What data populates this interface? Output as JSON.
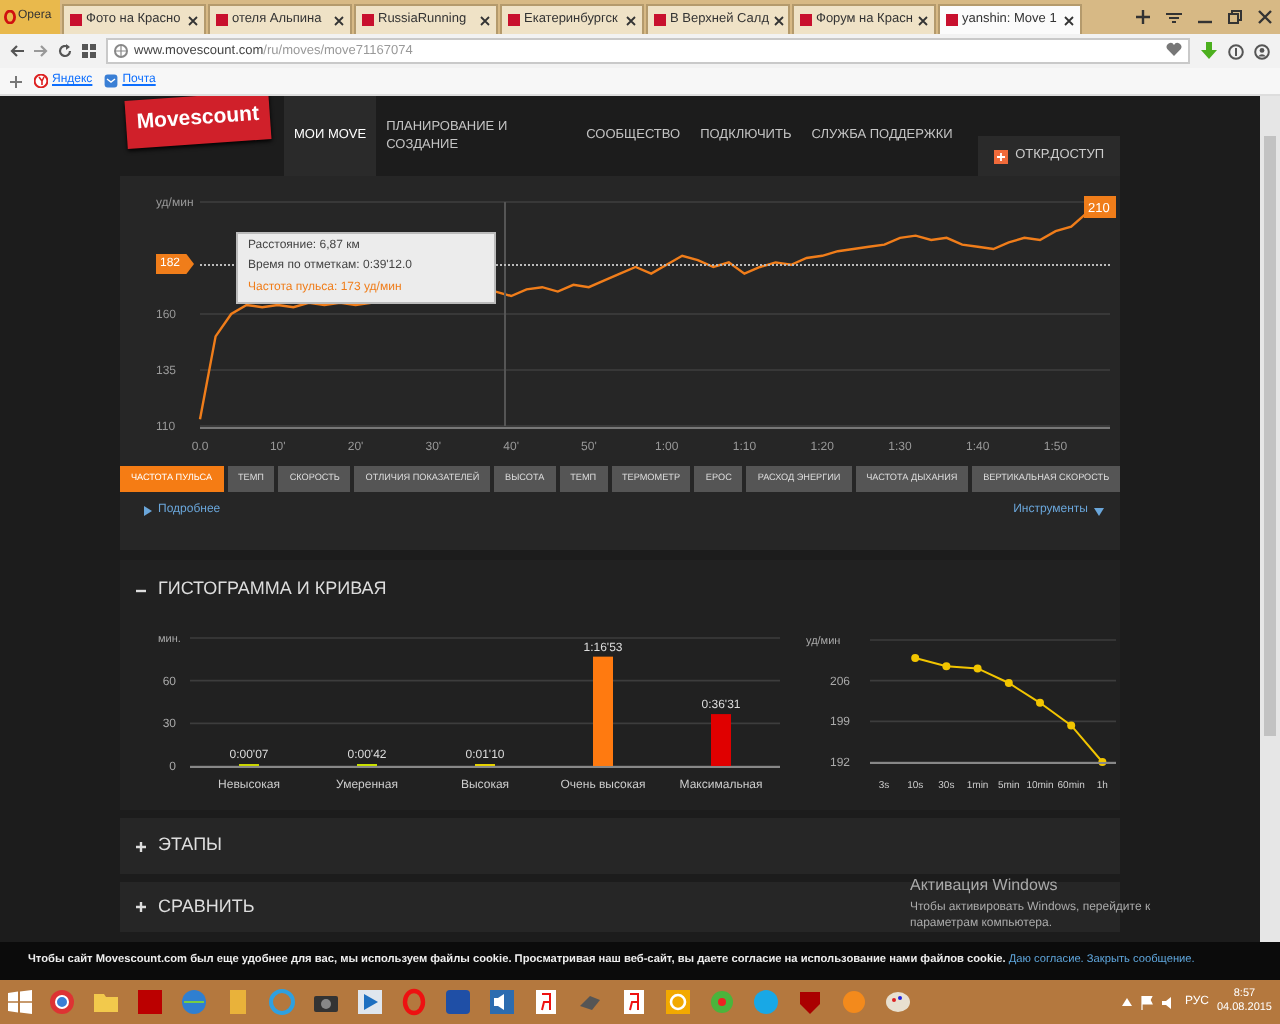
{
  "browser": {
    "menu_button": "Opera",
    "tabs": [
      {
        "title": "Фото на Красно",
        "selected": false
      },
      {
        "title": "отеля Альпина",
        "selected": false
      },
      {
        "title": "RussiaRunning",
        "selected": false
      },
      {
        "title": "Екатеринбургск",
        "selected": false
      },
      {
        "title": "В Верхней Салд",
        "selected": false
      },
      {
        "title": "Форум на Красн",
        "selected": false
      },
      {
        "title": "yanshin: Move 1",
        "selected": true
      }
    ],
    "address": {
      "host": "www.movescount.com",
      "path": "/ru/moves/move71167074"
    },
    "bookmarks": [
      "Яндекс",
      "Почта"
    ]
  },
  "site": {
    "logo": "Movescount",
    "nav": [
      {
        "label": "МОИ MOVE",
        "selected": true
      },
      {
        "label": "ПЛАНИРОВАНИЕ И СОЗДАНИЕ",
        "selected": false
      },
      {
        "label": "СООБЩЕСТВО",
        "selected": false
      },
      {
        "label": "ПОДКЛЮЧИТЬ",
        "selected": false
      },
      {
        "label": "СЛУЖБА ПОДДЕРЖКИ",
        "selected": false
      }
    ],
    "access_button": "ОТКР.ДОСТУП"
  },
  "graph": {
    "chart_data": {
      "type": "line",
      "ylabel": "уд/мин",
      "x": [
        0,
        2,
        4,
        6,
        8,
        10,
        12,
        14,
        16,
        18,
        20,
        22,
        24,
        26,
        28,
        30,
        32,
        34,
        36,
        38,
        40,
        42,
        44,
        46,
        48,
        50,
        52,
        54,
        56,
        58,
        60,
        62,
        64,
        66,
        68,
        70,
        72,
        74,
        76,
        78,
        80,
        82,
        84,
        86,
        88,
        90,
        92,
        94,
        96,
        98,
        100,
        102,
        104,
        106,
        108,
        110,
        112,
        114
      ],
      "series": [
        {
          "color": "#f07d1a",
          "values": [
            113,
            150,
            160,
            164,
            163,
            164,
            163,
            165,
            164,
            165,
            164,
            165,
            null,
            null,
            null,
            null,
            null,
            null,
            null,
            170,
            168,
            171,
            172,
            170,
            173,
            172,
            175,
            178,
            181,
            178,
            182,
            186,
            184,
            181,
            183,
            178,
            181,
            183,
            182,
            185,
            186,
            188,
            189,
            190,
            191,
            194,
            195,
            193,
            194,
            191,
            190,
            189,
            192,
            194,
            193,
            197,
            199,
            205
          ]
        }
      ],
      "xlim": [
        0,
        117
      ],
      "ylim": [
        110,
        210
      ],
      "xticks": [
        {
          "value": 0,
          "label": "0.0"
        },
        {
          "value": 10,
          "label": "10'"
        },
        {
          "value": 20,
          "label": "20'"
        },
        {
          "value": 30,
          "label": "30'"
        },
        {
          "value": 40,
          "label": "40'"
        },
        {
          "value": 50,
          "label": "50'"
        },
        {
          "value": 60,
          "label": "1:00"
        },
        {
          "value": 70,
          "label": "1:10"
        },
        {
          "value": 80,
          "label": "1:20"
        },
        {
          "value": 90,
          "label": "1:30"
        },
        {
          "value": 100,
          "label": "1:40"
        },
        {
          "value": 110,
          "label": "1:50"
        }
      ],
      "yticks": [
        110,
        135,
        160
      ]
    },
    "avg_marker": "182",
    "max_marker": "210",
    "tooltip": [
      {
        "kind": "info",
        "text": "Расстояние: 6,87 км"
      },
      {
        "kind": "info",
        "text": "Время по отметкам: 0:39'12.0"
      },
      {
        "kind": "highlight",
        "text": "Частота пульса: 173 уд/мин"
      }
    ],
    "metric_tabs": [
      {
        "label": "ЧАСТОТА ПУЛЬСА",
        "selected": true
      },
      {
        "label": "ТЕМП",
        "selected": false
      },
      {
        "label": "СКОРОСТЬ",
        "selected": false
      },
      {
        "label": "ОТЛИЧИЯ ПОКАЗАТЕЛЕЙ",
        "selected": false
      },
      {
        "label": "ВЫСОТА",
        "selected": false
      },
      {
        "label": "ТЕМП",
        "selected": false
      },
      {
        "label": "ТЕРМОМЕТР",
        "selected": false
      },
      {
        "label": "EPOC",
        "selected": false
      },
      {
        "label": "РАСХОД ЭНЕРГИИ",
        "selected": false
      },
      {
        "label": "ЧАСТОТА ДЫХАНИЯ",
        "selected": false
      },
      {
        "label": "ВЕРТИКАЛЬНАЯ СКОРОСТЬ",
        "selected": false
      }
    ],
    "details_link": "Подробнее",
    "tools_menu": "Инструменты"
  },
  "histogram_section": {
    "title": "ГИСТОГРАММА И КРИВАЯ",
    "expanded": true,
    "histogram": {
      "chart_data": {
        "type": "bar",
        "ylabel": "мин.",
        "categories": [
          "Невысокая",
          "Умеренная",
          "Высокая",
          "Очень высокая",
          "Максимальная"
        ],
        "series": [
          {
            "values": [
              0.1,
              0.7,
              1.2,
              76.9,
              36.5
            ]
          }
        ],
        "ylim": [
          0,
          90
        ],
        "yticks": [
          0,
          30,
          60
        ],
        "value_labels": [
          "0:00'07",
          "0:00'42",
          "0:01'10",
          "1:16'53",
          "0:36'31"
        ]
      }
    },
    "curve": {
      "chart_data": {
        "type": "line",
        "ylabel": "уд/мин",
        "categories": [
          "3s",
          "10s",
          "30s",
          "1min",
          "5min",
          "10min",
          "60min",
          "1h"
        ],
        "series": [
          {
            "color": "#f2c500",
            "marker": "o",
            "values": [
              null,
              209.9,
              208.5,
              208.1,
              205.6,
              202.2,
              198.3,
              192
            ]
          }
        ],
        "ylim": [
          192,
          213
        ],
        "yticks": [
          192,
          199,
          206
        ]
      }
    }
  },
  "sections": [
    {
      "title": "ЭТАПЫ",
      "expanded": false
    },
    {
      "title": "СРАВНИТЬ",
      "expanded": false
    }
  ],
  "os_notice": {
    "title": "Активация Windows",
    "text": "Чтобы активировать Windows, перейдите к параметрам компьютера."
  },
  "cookie_bar": {
    "text": "Чтобы сайт Movescount.com был еще удобнее для вас, мы используем файлы cookie. Просматривая наш веб-сайт, вы даете согласие на использование нами файлов cookie.",
    "links": [
      "Даю согласие.",
      "Закрыть сообщение."
    ]
  },
  "taskbar": {
    "language": "РУС",
    "time": "8:57",
    "date": "04.08.2015"
  }
}
